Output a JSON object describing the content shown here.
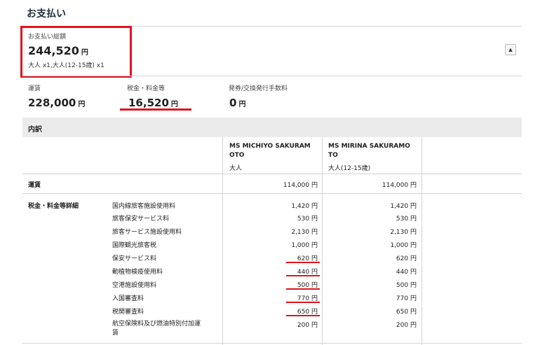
{
  "section_title": "お支払い",
  "total": {
    "label": "お支払い総額",
    "amount": "244,520",
    "unit": "円",
    "passengers": "大人 x1,大人(12-15歳) x1",
    "collapse_icon": "▲"
  },
  "summary": {
    "fare": {
      "label": "運賃",
      "amount": "228,000",
      "unit": "円"
    },
    "taxes": {
      "label": "税金・料金等",
      "amount": "16,520",
      "unit": "円"
    },
    "fee": {
      "label": "発券/交換発行手数料",
      "amount": "0",
      "unit": "円"
    }
  },
  "breakdown": {
    "title": "内訳",
    "passengers": [
      {
        "name_line1": "MS MICHIYO SAKURAM",
        "name_line2": "OTO",
        "type": "大人"
      },
      {
        "name_line1": "MS MIRINA SAKURAMO",
        "name_line2": "TO",
        "type": "大人(12-15歳)"
      }
    ],
    "fare_row": {
      "label": "運賃",
      "values": [
        "114,000",
        "114,000"
      ],
      "unit": "円"
    },
    "tax_group_label": "税金・料金等詳細",
    "tax_items": [
      {
        "label": "国内線旅客施設使用料",
        "values": [
          "1,420",
          "1,420"
        ],
        "unit": "円"
      },
      {
        "label": "旅客保安サービス料",
        "values": [
          "530",
          "530"
        ],
        "unit": "円"
      },
      {
        "label": "旅客サービス施設使用料",
        "values": [
          "2,130",
          "2,130"
        ],
        "unit": "円"
      },
      {
        "label": "国際観光旅客税",
        "values": [
          "1,000",
          "1,000"
        ],
        "unit": "円"
      },
      {
        "label": "保安サービス料",
        "values": [
          "620",
          "620"
        ],
        "unit": "円"
      },
      {
        "label": "動植物検疫使用料",
        "values": [
          "440",
          "440"
        ],
        "unit": "円"
      },
      {
        "label": "空港施設使用料",
        "values": [
          "500",
          "500"
        ],
        "unit": "円"
      },
      {
        "label": "入国審査料",
        "values": [
          "770",
          "770"
        ],
        "unit": "円"
      },
      {
        "label": "税関審査料",
        "values": [
          "650",
          "650"
        ],
        "unit": "円"
      },
      {
        "label_line1": "航空保険料及び燃油特別付加運",
        "label_line2": "賃",
        "values": [
          "200",
          "200"
        ],
        "unit": "円"
      }
    ]
  },
  "colors": {
    "highlight": "#e0141e",
    "band": "#ebebeb",
    "divider": "#d4d4d4",
    "title": "#1f2d3d"
  }
}
